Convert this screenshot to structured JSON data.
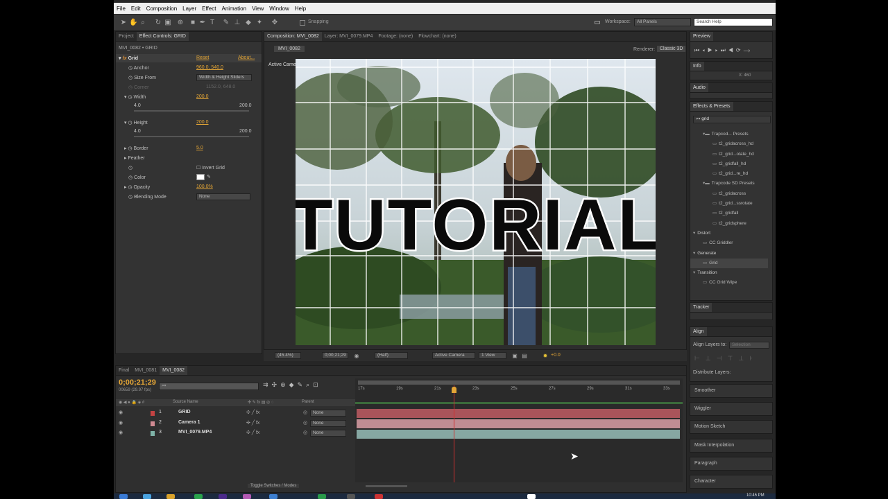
{
  "menu": [
    "File",
    "Edit",
    "Composition",
    "Layer",
    "Effect",
    "Animation",
    "View",
    "Window",
    "Help"
  ],
  "toolbar": {
    "snapping": "Snapping",
    "workspace_label": "Workspace:",
    "workspace_value": "All Panels",
    "search_placeholder": "Search Help"
  },
  "left_tabs": {
    "project": "Project",
    "effect_controls": "Effect Controls: GRID"
  },
  "effect_controls": {
    "breadcrumb": "MVI_0082 • GRID",
    "effect": "Grid",
    "reset": "Reset",
    "about": "About...",
    "anchor_label": "Anchor",
    "anchor_value": "960.0, 540.0",
    "size_from_label": "Size From",
    "size_from_value": "Width & Height Sliders",
    "corner_label": "Corner",
    "corner_value": "1152.0, 648.0",
    "width_label": "Width",
    "width_value": "200.0",
    "width_min": "4.0",
    "width_max": "200.0",
    "height_label": "Height",
    "height_value": "200.0",
    "height_min": "4.0",
    "height_max": "200.0",
    "border_label": "Border",
    "border_value": "5.0",
    "feather_label": "Feather",
    "invert_label": "Invert Grid",
    "color_label": "Color",
    "opacity_label": "Opacity",
    "opacity_value": "100.0%",
    "blending_label": "Blending Mode",
    "blending_value": "None"
  },
  "comp_tabs": {
    "composition": "Composition: MVI_0082",
    "layer": "Layer: MVI_0079.MP4",
    "footage": "Footage: (none)",
    "flowchart": "Flowchart: (none)"
  },
  "comp": {
    "subtab": "MVI_0082",
    "renderer_label": "Renderer:",
    "renderer_value": "Classic 3D",
    "camera_label": "Active Camera",
    "overlay_text": "TUTORIAL"
  },
  "viewer_bar": {
    "zoom": "(45.4%)",
    "timecode": "0;00;21;29",
    "resolution": "(Half)",
    "camera": "Active Camera",
    "view": "1 View",
    "exposure": "+0.0"
  },
  "timeline": {
    "tabs": [
      "Final",
      "MVI_0081",
      "MVI_0082"
    ],
    "timecode": "0;00;21;29",
    "frames": "00659 (29.97 fps)",
    "col_source": "Source Name",
    "col_parent": "Parent",
    "ruler": [
      "17s",
      "19s",
      "21s",
      "23s",
      "25s",
      "27s",
      "29s",
      "31s",
      "33s"
    ],
    "layers": [
      {
        "num": "1",
        "name": "GRID",
        "parent": "None",
        "color": "#c44343",
        "bar": "#a9545a"
      },
      {
        "num": "2",
        "name": "Camera 1",
        "parent": "None",
        "color": "#d08a92",
        "bar": "#c08d93"
      },
      {
        "num": "3",
        "name": "MVI_0079.MP4",
        "parent": "None",
        "color": "#7fb3a8",
        "bar": "#86a7a2"
      }
    ],
    "toggle": "Toggle Switches / Modes",
    "playhead_fraction": 0.3
  },
  "right": {
    "preview": "Preview",
    "info": "Info",
    "info_value": "X: 460",
    "audio": "Audio",
    "effects_presets": "Effects & Presets",
    "search_value": "grid",
    "tree": [
      {
        "t": "Trapcod... Presets",
        "lvl": 1,
        "folder": true
      },
      {
        "t": "t2_gridacross_hd",
        "lvl": 2
      },
      {
        "t": "t2_grid...otate_hd",
        "lvl": 2
      },
      {
        "t": "t2_gridfall_hd",
        "lvl": 2
      },
      {
        "t": "t2_grid...re_hd",
        "lvl": 2
      },
      {
        "t": "Trapcode SD Presets",
        "lvl": 1,
        "folder": true
      },
      {
        "t": "t2_gridacross",
        "lvl": 2
      },
      {
        "t": "t2_grid...ssrotate",
        "lvl": 2
      },
      {
        "t": "t2_gridfall",
        "lvl": 2
      },
      {
        "t": "t2_gridsphere",
        "lvl": 2
      },
      {
        "t": "Distort",
        "lvl": 0
      },
      {
        "t": "CC Griddler",
        "lvl": 1
      },
      {
        "t": "Generate",
        "lvl": 0
      },
      {
        "t": "Grid",
        "lvl": 1,
        "selected": true
      },
      {
        "t": "Transition",
        "lvl": 0
      },
      {
        "t": "CC Grid Wipe",
        "lvl": 1
      }
    ],
    "tracker": "Tracker",
    "align": "Align",
    "align_to": "Align Layers to:",
    "align_sel": "Selection",
    "distribute": "Distribute Layers:",
    "panels": [
      "Smoother",
      "Wiggler",
      "Motion Sketch",
      "Mask Interpolation",
      "Paragraph",
      "Character"
    ]
  },
  "clock": "10:45 PM",
  "colors": {
    "accent": "#e3a536",
    "panel": "#333333",
    "timeline_playhead": "#d03030"
  }
}
